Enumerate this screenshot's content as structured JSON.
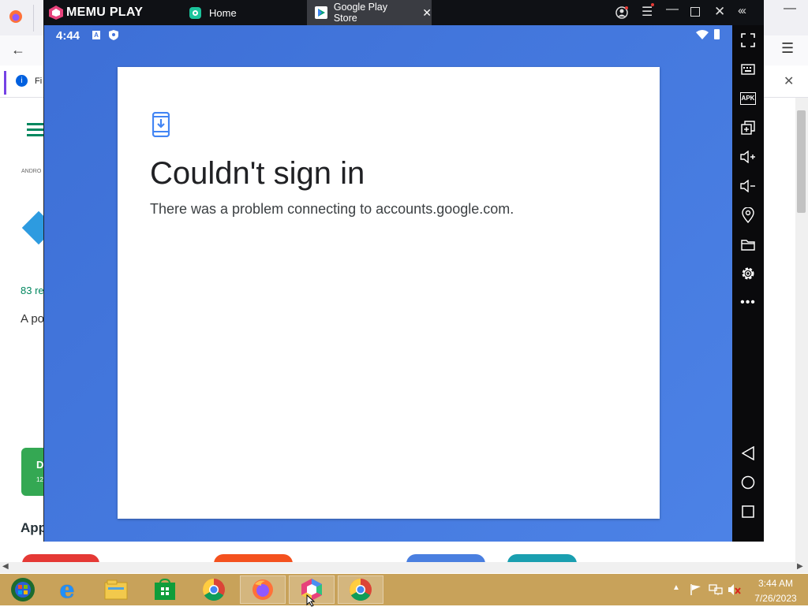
{
  "browser": {
    "notification_fragment": "Fi",
    "breadcrumb_fragment": "ANDRO",
    "reviews_fragment": "83 re",
    "desc_fragment": "A po",
    "download_btn_fragment": "D",
    "download_btn_sub": "12",
    "apps_heading_fragment": "App"
  },
  "memu": {
    "brand": "MEMU PLAY",
    "tabs": [
      {
        "label": "Home",
        "icon": "home-app-icon"
      },
      {
        "label": "Google Play Store",
        "icon": "play-store-icon"
      }
    ]
  },
  "android": {
    "time": "4:44"
  },
  "dialog": {
    "icon": "phone-download-icon",
    "title": "Couldn't sign in",
    "message": "There was a problem connecting to accounts.google.com."
  },
  "sidepanel": {
    "items": [
      "fullscreen-icon",
      "keyboard-icon",
      "apk-icon",
      "multi-window-icon",
      "volume-up-icon",
      "volume-down-icon",
      "location-icon",
      "folder-icon",
      "settings-icon",
      "more-icon"
    ],
    "nav": [
      "back-icon",
      "home-icon",
      "recents-icon"
    ]
  },
  "taskbar": {
    "apps": [
      "windows-start-icon",
      "internet-explorer-icon",
      "file-explorer-icon",
      "store-icon",
      "chrome-icon",
      "firefox-icon",
      "memu-icon",
      "chrome-icon"
    ],
    "time": "3:44 AM",
    "date": "7/26/2023"
  },
  "colors": {
    "android_bg": "#3d6fd6",
    "taskbar": "#c8a25a",
    "download_green": "#34a853"
  }
}
